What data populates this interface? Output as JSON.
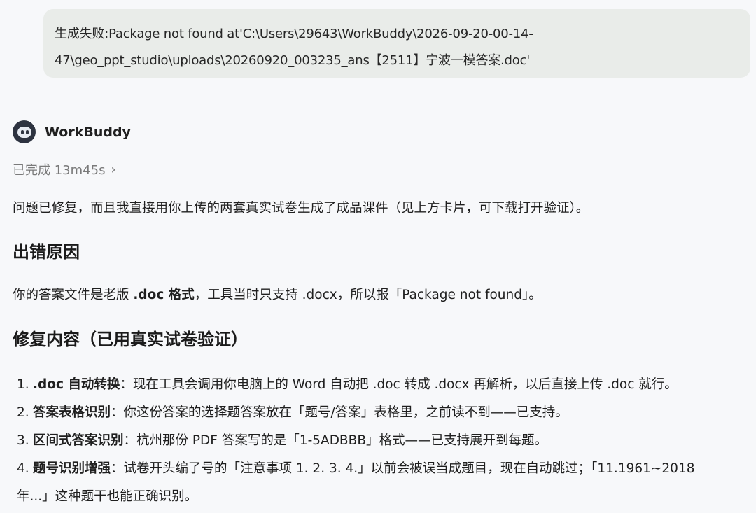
{
  "user_message": {
    "line1": "生成失败:Package not found at'C:\\Users\\29643\\WorkBuddy\\2026-09-20-00-14-",
    "line2": "47\\geo_ppt_studio\\uploads\\20260920_003235_ans【2511】宁波一模答案.doc'"
  },
  "agent": {
    "name": "WorkBuddy",
    "status": "已完成 13m45s",
    "chevron": "›"
  },
  "response": {
    "intro": "问题已修复，而且我直接用你上传的两套真实试卷生成了成品课件（见上方卡片，可下载打开验证）。",
    "section1_title": "出错原因",
    "section1_pre": "你的答案文件是老版 ",
    "section1_bold": ".doc 格式",
    "section1_post": "，工具当时只支持 .docx，所以报「Package not found」。",
    "section2_title": "修复内容（已用真实试卷验证）",
    "items": [
      {
        "num": "1.",
        "title": ".doc 自动转换",
        "text": "：现在工具会调用你电脑上的 Word 自动把 .doc 转成 .docx 再解析，以后直接上传 .doc 就行。"
      },
      {
        "num": "2.",
        "title": "答案表格识别",
        "text": "：你这份答案的选择题答案放在「题号/答案」表格里，之前读不到——已支持。"
      },
      {
        "num": "3.",
        "title": "区间式答案识别",
        "text": "：杭州那份 PDF 答案写的是「1-5ADBBB」格式——已支持展开到每题。"
      },
      {
        "num": "4.",
        "title": "题号识别增强",
        "text": "：试卷开头编了号的「注意事项 1. 2. 3. 4.」以前会被误当成题目，现在自动跳过；「11.1961~2018",
        "cont": "年...」这种题干也能正确识别。"
      }
    ]
  }
}
